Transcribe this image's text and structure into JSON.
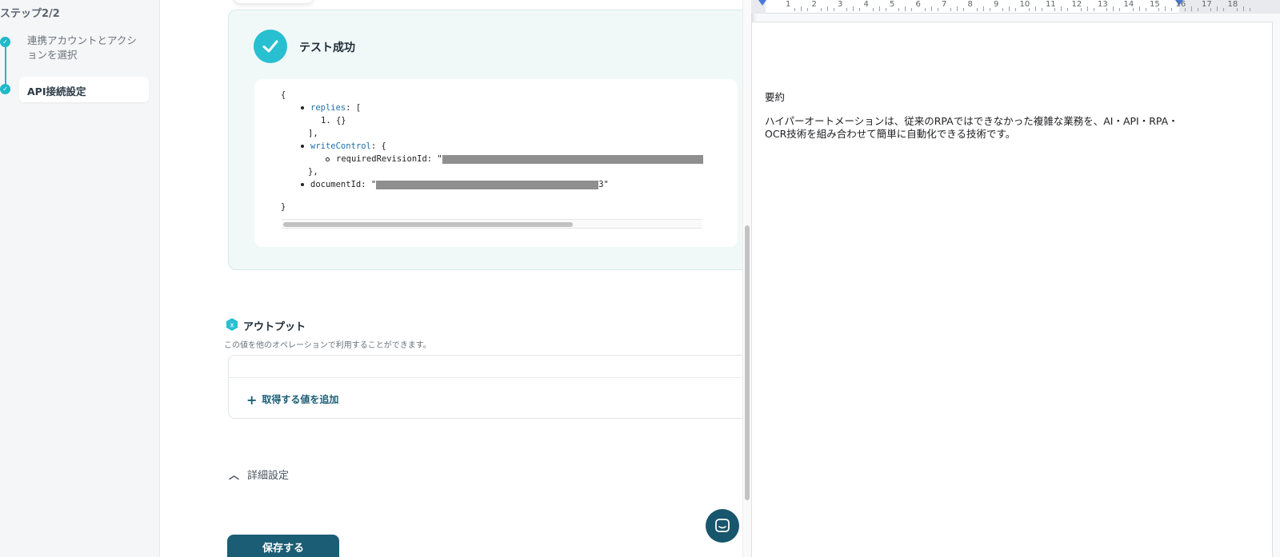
{
  "sidebar": {
    "step_title": "ステップ2/2",
    "steps": [
      {
        "label": "連携アカウントとアクションを選択"
      },
      {
        "label": "API接続設定"
      }
    ]
  },
  "test_result": {
    "title": "テスト成功",
    "json": {
      "open_brace": "{",
      "replies_key": "replies",
      "replies_open": ": [",
      "replies_item": "1. {}",
      "replies_close": "],",
      "write_control_key": "writeControl",
      "write_control_open": ": {",
      "required_revision_key": "requiredRevisionId: \"",
      "write_control_close": "},",
      "document_id_key": "documentId: \"",
      "document_id_tail": "3\"",
      "close_brace": "}"
    }
  },
  "output": {
    "title": "アウトプット",
    "description": "この値を他のオペレーションで利用することができます。",
    "add_value_label": "取得する値を追加"
  },
  "advanced": {
    "label": "詳細設定"
  },
  "save_button": {
    "label": "保存する"
  },
  "icons": {
    "step_check": "check-icon",
    "success": "check-circle-icon",
    "output": "variable-icon",
    "add": "plus-icon",
    "chevron": "chevron-up-icon",
    "chat": "chat-icon"
  },
  "colors": {
    "accent": "#28bfd1",
    "primary": "#1b5d74",
    "success_bg": "#f1f8f8"
  },
  "document": {
    "ruler_numbers": [
      "1",
      "2",
      "3",
      "4",
      "5",
      "6",
      "7",
      "8",
      "9",
      "10",
      "11",
      "12",
      "13",
      "14",
      "15",
      "16",
      "17",
      "18"
    ],
    "heading": "要約",
    "body": "ハイパーオートメーションは、従来のRPAではできなかった複雑な業務を、AI・API・RPA・OCR技術を組み合わせて簡単に自動化できる技術です。"
  }
}
